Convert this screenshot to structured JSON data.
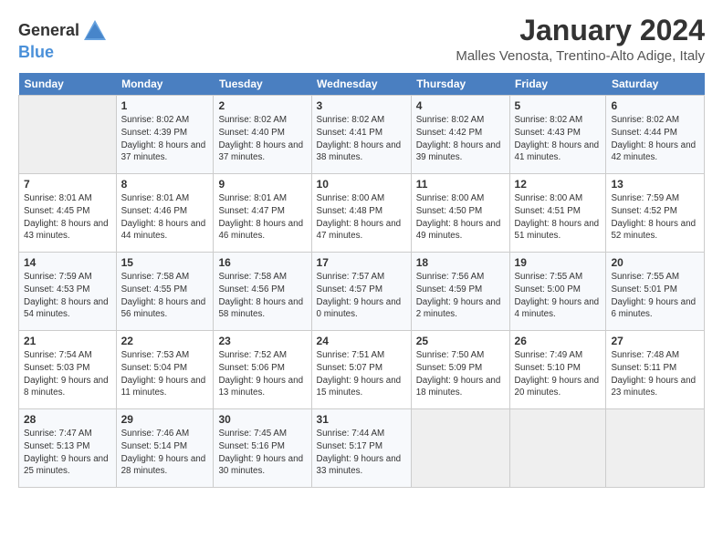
{
  "header": {
    "logo_general": "General",
    "logo_blue": "Blue",
    "month_title": "January 2024",
    "location": "Malles Venosta, Trentino-Alto Adige, Italy"
  },
  "columns": [
    "Sunday",
    "Monday",
    "Tuesday",
    "Wednesday",
    "Thursday",
    "Friday",
    "Saturday"
  ],
  "weeks": [
    [
      {
        "day": "",
        "sunrise": "",
        "sunset": "",
        "daylight": ""
      },
      {
        "day": "1",
        "sunrise": "Sunrise: 8:02 AM",
        "sunset": "Sunset: 4:39 PM",
        "daylight": "Daylight: 8 hours and 37 minutes."
      },
      {
        "day": "2",
        "sunrise": "Sunrise: 8:02 AM",
        "sunset": "Sunset: 4:40 PM",
        "daylight": "Daylight: 8 hours and 37 minutes."
      },
      {
        "day": "3",
        "sunrise": "Sunrise: 8:02 AM",
        "sunset": "Sunset: 4:41 PM",
        "daylight": "Daylight: 8 hours and 38 minutes."
      },
      {
        "day": "4",
        "sunrise": "Sunrise: 8:02 AM",
        "sunset": "Sunset: 4:42 PM",
        "daylight": "Daylight: 8 hours and 39 minutes."
      },
      {
        "day": "5",
        "sunrise": "Sunrise: 8:02 AM",
        "sunset": "Sunset: 4:43 PM",
        "daylight": "Daylight: 8 hours and 41 minutes."
      },
      {
        "day": "6",
        "sunrise": "Sunrise: 8:02 AM",
        "sunset": "Sunset: 4:44 PM",
        "daylight": "Daylight: 8 hours and 42 minutes."
      }
    ],
    [
      {
        "day": "7",
        "sunrise": "Sunrise: 8:01 AM",
        "sunset": "Sunset: 4:45 PM",
        "daylight": "Daylight: 8 hours and 43 minutes."
      },
      {
        "day": "8",
        "sunrise": "Sunrise: 8:01 AM",
        "sunset": "Sunset: 4:46 PM",
        "daylight": "Daylight: 8 hours and 44 minutes."
      },
      {
        "day": "9",
        "sunrise": "Sunrise: 8:01 AM",
        "sunset": "Sunset: 4:47 PM",
        "daylight": "Daylight: 8 hours and 46 minutes."
      },
      {
        "day": "10",
        "sunrise": "Sunrise: 8:00 AM",
        "sunset": "Sunset: 4:48 PM",
        "daylight": "Daylight: 8 hours and 47 minutes."
      },
      {
        "day": "11",
        "sunrise": "Sunrise: 8:00 AM",
        "sunset": "Sunset: 4:50 PM",
        "daylight": "Daylight: 8 hours and 49 minutes."
      },
      {
        "day": "12",
        "sunrise": "Sunrise: 8:00 AM",
        "sunset": "Sunset: 4:51 PM",
        "daylight": "Daylight: 8 hours and 51 minutes."
      },
      {
        "day": "13",
        "sunrise": "Sunrise: 7:59 AM",
        "sunset": "Sunset: 4:52 PM",
        "daylight": "Daylight: 8 hours and 52 minutes."
      }
    ],
    [
      {
        "day": "14",
        "sunrise": "Sunrise: 7:59 AM",
        "sunset": "Sunset: 4:53 PM",
        "daylight": "Daylight: 8 hours and 54 minutes."
      },
      {
        "day": "15",
        "sunrise": "Sunrise: 7:58 AM",
        "sunset": "Sunset: 4:55 PM",
        "daylight": "Daylight: 8 hours and 56 minutes."
      },
      {
        "day": "16",
        "sunrise": "Sunrise: 7:58 AM",
        "sunset": "Sunset: 4:56 PM",
        "daylight": "Daylight: 8 hours and 58 minutes."
      },
      {
        "day": "17",
        "sunrise": "Sunrise: 7:57 AM",
        "sunset": "Sunset: 4:57 PM",
        "daylight": "Daylight: 9 hours and 0 minutes."
      },
      {
        "day": "18",
        "sunrise": "Sunrise: 7:56 AM",
        "sunset": "Sunset: 4:59 PM",
        "daylight": "Daylight: 9 hours and 2 minutes."
      },
      {
        "day": "19",
        "sunrise": "Sunrise: 7:55 AM",
        "sunset": "Sunset: 5:00 PM",
        "daylight": "Daylight: 9 hours and 4 minutes."
      },
      {
        "day": "20",
        "sunrise": "Sunrise: 7:55 AM",
        "sunset": "Sunset: 5:01 PM",
        "daylight": "Daylight: 9 hours and 6 minutes."
      }
    ],
    [
      {
        "day": "21",
        "sunrise": "Sunrise: 7:54 AM",
        "sunset": "Sunset: 5:03 PM",
        "daylight": "Daylight: 9 hours and 8 minutes."
      },
      {
        "day": "22",
        "sunrise": "Sunrise: 7:53 AM",
        "sunset": "Sunset: 5:04 PM",
        "daylight": "Daylight: 9 hours and 11 minutes."
      },
      {
        "day": "23",
        "sunrise": "Sunrise: 7:52 AM",
        "sunset": "Sunset: 5:06 PM",
        "daylight": "Daylight: 9 hours and 13 minutes."
      },
      {
        "day": "24",
        "sunrise": "Sunrise: 7:51 AM",
        "sunset": "Sunset: 5:07 PM",
        "daylight": "Daylight: 9 hours and 15 minutes."
      },
      {
        "day": "25",
        "sunrise": "Sunrise: 7:50 AM",
        "sunset": "Sunset: 5:09 PM",
        "daylight": "Daylight: 9 hours and 18 minutes."
      },
      {
        "day": "26",
        "sunrise": "Sunrise: 7:49 AM",
        "sunset": "Sunset: 5:10 PM",
        "daylight": "Daylight: 9 hours and 20 minutes."
      },
      {
        "day": "27",
        "sunrise": "Sunrise: 7:48 AM",
        "sunset": "Sunset: 5:11 PM",
        "daylight": "Daylight: 9 hours and 23 minutes."
      }
    ],
    [
      {
        "day": "28",
        "sunrise": "Sunrise: 7:47 AM",
        "sunset": "Sunset: 5:13 PM",
        "daylight": "Daylight: 9 hours and 25 minutes."
      },
      {
        "day": "29",
        "sunrise": "Sunrise: 7:46 AM",
        "sunset": "Sunset: 5:14 PM",
        "daylight": "Daylight: 9 hours and 28 minutes."
      },
      {
        "day": "30",
        "sunrise": "Sunrise: 7:45 AM",
        "sunset": "Sunset: 5:16 PM",
        "daylight": "Daylight: 9 hours and 30 minutes."
      },
      {
        "day": "31",
        "sunrise": "Sunrise: 7:44 AM",
        "sunset": "Sunset: 5:17 PM",
        "daylight": "Daylight: 9 hours and 33 minutes."
      },
      {
        "day": "",
        "sunrise": "",
        "sunset": "",
        "daylight": ""
      },
      {
        "day": "",
        "sunrise": "",
        "sunset": "",
        "daylight": ""
      },
      {
        "day": "",
        "sunrise": "",
        "sunset": "",
        "daylight": ""
      }
    ]
  ]
}
